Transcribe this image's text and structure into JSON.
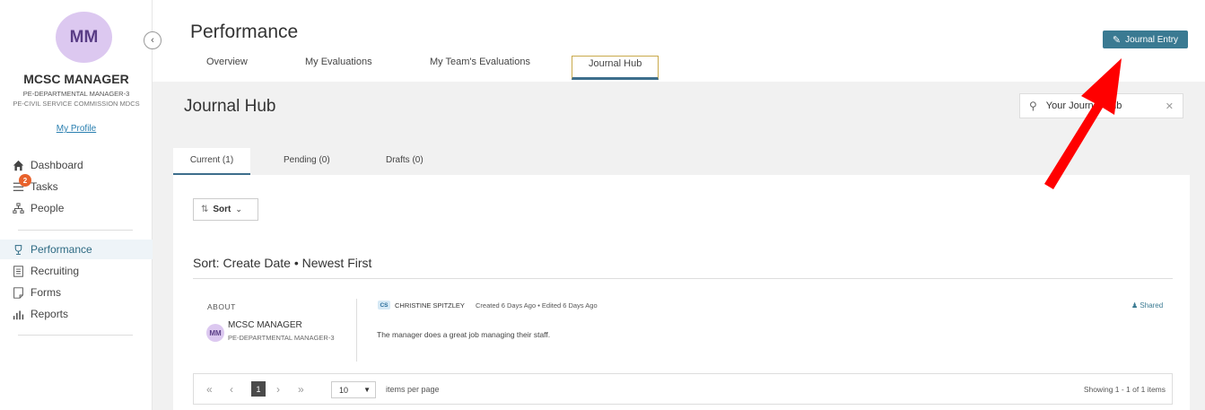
{
  "sidebar": {
    "avatar_initials": "MM",
    "user_name": "MCSC MANAGER",
    "user_title": "PE-DEPARTMENTAL MANAGER-3",
    "user_org": "PE-CIVIL SERVICE COMMISSION MDCS",
    "profile_link": "My Profile",
    "tasks_badge": "2",
    "nav": [
      {
        "label": "Dashboard",
        "icon": "home-icon"
      },
      {
        "label": "Tasks",
        "icon": "list-icon"
      },
      {
        "label": "People",
        "icon": "org-chart-icon"
      },
      {
        "label": "Performance",
        "icon": "trophy-icon"
      },
      {
        "label": "Recruiting",
        "icon": "document-icon"
      },
      {
        "label": "Forms",
        "icon": "form-icon"
      },
      {
        "label": "Reports",
        "icon": "bar-chart-icon"
      }
    ]
  },
  "header": {
    "title": "Performance",
    "tabs": [
      "Overview",
      "My Evaluations",
      "My Team's Evaluations",
      "Journal Hub"
    ],
    "active_tab": "Journal Hub",
    "journal_button": "Journal Entry"
  },
  "hub": {
    "title": "Journal Hub",
    "search_value": "Your Journal Hub",
    "sub_tabs": [
      "Current (1)",
      "Pending (0)",
      "Drafts (0)"
    ],
    "sort_button": "Sort",
    "sort_label": "Sort: Create Date • Newest First"
  },
  "entry": {
    "about_label": "ABOUT",
    "about_initials": "MM",
    "about_name": "MCSC MANAGER",
    "about_role": "PE-DEPARTMENTAL MANAGER-3",
    "author_initials": "CS",
    "author_name": "CHRISTINE SPITZLEY",
    "meta": "Created 6 Days Ago • Edited 6 Days Ago",
    "shared": "Shared",
    "text": "The manager does a great job managing their staff."
  },
  "pager": {
    "current_page": "1",
    "per_page": "10",
    "per_page_label": "items per page",
    "showing": "Showing 1 - 1 of 1 items"
  },
  "colors": {
    "accent": "#3a7a92",
    "avatar": "#dcc8f0",
    "badge": "#e8622c",
    "annotation_arrow": "#ff0000"
  }
}
